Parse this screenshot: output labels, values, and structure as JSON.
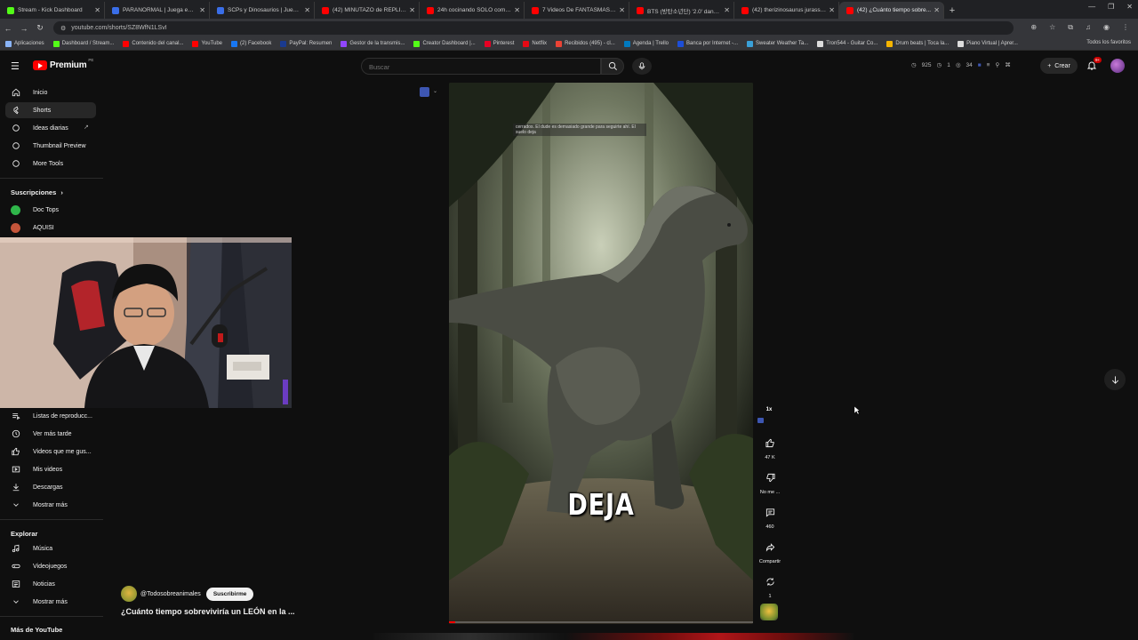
{
  "browser": {
    "tabs": [
      {
        "label": "Stream - Kick Dashboard",
        "color": "#53fc18"
      },
      {
        "label": "PARANORMAL | Juega en Rob...",
        "color": "#3a6ee8"
      },
      {
        "label": "SCPs y Dinosaurios | Juega en F...",
        "color": "#3a6ee8"
      },
      {
        "label": "(42) MINUTAZO de REPLIK vs V...",
        "color": "#ff0000"
      },
      {
        "label": "24h cocinando SOLO comida p...",
        "color": "#ff0000"
      },
      {
        "label": "7 Videos De FANTASMAS Que...",
        "color": "#ff0000"
      },
      {
        "label": "BTS (방탄소년단) '2.0' dance c...",
        "color": "#ff0000"
      },
      {
        "label": "(42) therizinosaurus jurassic wo...",
        "color": "#ff0000"
      },
      {
        "label": "(42) ¿Cuánto tiempo sobre...",
        "color": "#ff0000"
      }
    ],
    "url": "youtube.com/shorts/SZ8WfN1LSvI",
    "bookmarks": [
      {
        "label": "Aplicaciones",
        "color": "#8ab4f8"
      },
      {
        "label": "Dashboard / Stream...",
        "color": "#53fc18"
      },
      {
        "label": "Contenido del canal...",
        "color": "#ff0000"
      },
      {
        "label": "YouTube",
        "color": "#ff0000"
      },
      {
        "label": "(2) Facebook",
        "color": "#1877f2"
      },
      {
        "label": "PayPal: Resumen",
        "color": "#1a3a8f"
      },
      {
        "label": "Gestor de la transmis...",
        "color": "#9146ff"
      },
      {
        "label": "Creator Dashboard |...",
        "color": "#53fc18"
      },
      {
        "label": "Pinterest",
        "color": "#e60023"
      },
      {
        "label": "Netflix",
        "color": "#e50914"
      },
      {
        "label": "Recibidos (495) - cl...",
        "color": "#ea4335"
      },
      {
        "label": "Agenda | Trello",
        "color": "#0079bf"
      },
      {
        "label": "Banca por Internet -...",
        "color": "#1d4ed8"
      },
      {
        "label": "Sweater Weather Ta...",
        "color": "#3aa0d8"
      },
      {
        "label": "Tron544 - Guitar Co...",
        "color": "#dddddd"
      },
      {
        "label": "Drum beats | Toca la...",
        "color": "#f5b400"
      },
      {
        "label": "Piano Virtual | Aprer...",
        "color": "#dddddd"
      }
    ],
    "bookmarks_all": "Todos los favoritos"
  },
  "masthead": {
    "logo_text": "Premium",
    "country": "PE",
    "search_placeholder": "Buscar",
    "stats": {
      "views": "925",
      "likes": "1",
      "viewers": "34"
    },
    "create_label": "Crear",
    "notif_count": "9+"
  },
  "sidebar": {
    "main": [
      {
        "label": "Inicio",
        "icon": "home-icon"
      },
      {
        "label": "Shorts",
        "icon": "shorts-icon",
        "active": true
      },
      {
        "label": "Ideas diarias",
        "icon": "bulb-icon"
      },
      {
        "label": "Thumbnail Preview",
        "icon": "preview-icon"
      },
      {
        "label": "More Tools",
        "icon": "tools-icon"
      }
    ],
    "subs_title": "Suscripciones",
    "subs": [
      {
        "label": "Doc Tops",
        "color": "#2fb64a"
      },
      {
        "label": "AQUISI",
        "color": "#c4553a"
      }
    ],
    "library": [
      {
        "label": "Listas de reproducc...",
        "icon": "playlist-icon"
      },
      {
        "label": "Ver más tarde",
        "icon": "clock-icon"
      },
      {
        "label": "Videos que me gus...",
        "icon": "thumb-up-icon"
      },
      {
        "label": "Mis videos",
        "icon": "video-icon"
      },
      {
        "label": "Descargas",
        "icon": "download-icon"
      },
      {
        "label": "Mostrar más",
        "icon": "chevron-down-icon"
      }
    ],
    "explore_title": "Explorar",
    "explore": [
      {
        "label": "Música",
        "icon": "music-icon"
      },
      {
        "label": "Videojuegos",
        "icon": "gamepad-icon"
      },
      {
        "label": "Noticias",
        "icon": "news-icon"
      },
      {
        "label": "Mostrar más",
        "icon": "chevron-down-icon"
      }
    ],
    "more_title": "Más de YouTube"
  },
  "short": {
    "caption_small": "cerrados. El dude es demasiado grande para seguirte ahí. El suelo deja",
    "caption_big": "DEJA",
    "channel": "@Todosobreanimales",
    "subscribe_label": "Suscribirme",
    "title": "¿Cuánto tiempo sobreviviría un LEÓN en la ...",
    "progress": 0.02,
    "speed": "1x",
    "likes": "47 K",
    "dislike_label": "No me ...",
    "comments": "460",
    "share_label": "Compartir",
    "remix_count": "1"
  }
}
